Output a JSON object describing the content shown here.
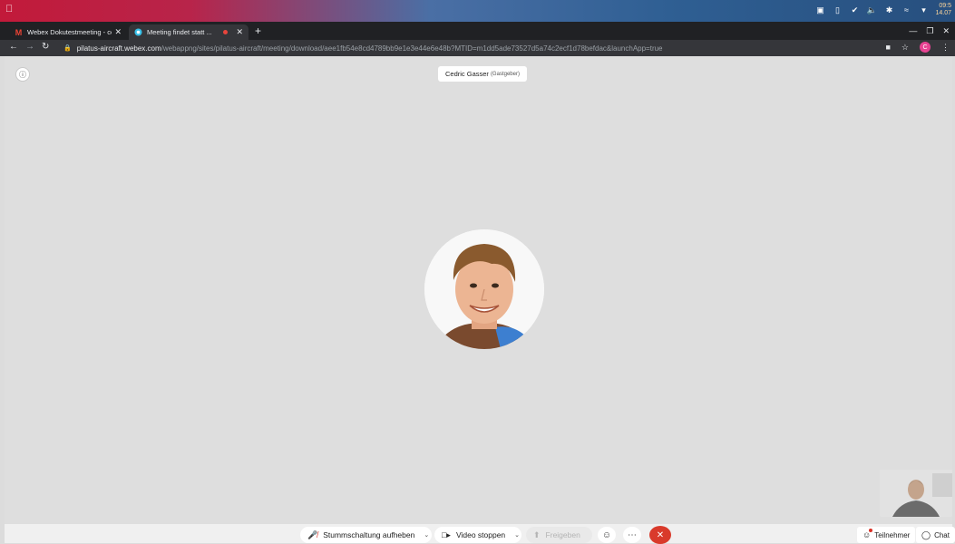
{
  "os": {
    "clock": "09:5\n14.07"
  },
  "browser": {
    "tabs": [
      {
        "title": "Webex Dokutestmeeting - co",
        "icon": "gmail-icon"
      },
      {
        "title": "Meeting findet statt ...",
        "icon": "webex-icon"
      }
    ],
    "url_host": "pilatus-aircraft.webex.com",
    "url_path": "/webappng/sites/pilatus-aircraft/meeting/download/aee1fb54e8cd4789bb9e1e3e44e6e48b?MTID=m1dd5ade73527d5a74c2ecf1d78befdac&launchApp=true",
    "profile_initial": "C"
  },
  "meeting": {
    "host_name": "Cedric Gasser",
    "host_role": "(Gastgeber)",
    "controls": {
      "mute_label": "Stummschaltung aufheben",
      "video_label": "Video stoppen",
      "share_label": "Freigeben",
      "participants_label": "Teilnehmer",
      "chat_label": "Chat"
    }
  },
  "colors": {
    "leave_button": "#d93a2b",
    "mute_icon": "#d93025",
    "stage_background": "#dedede"
  }
}
